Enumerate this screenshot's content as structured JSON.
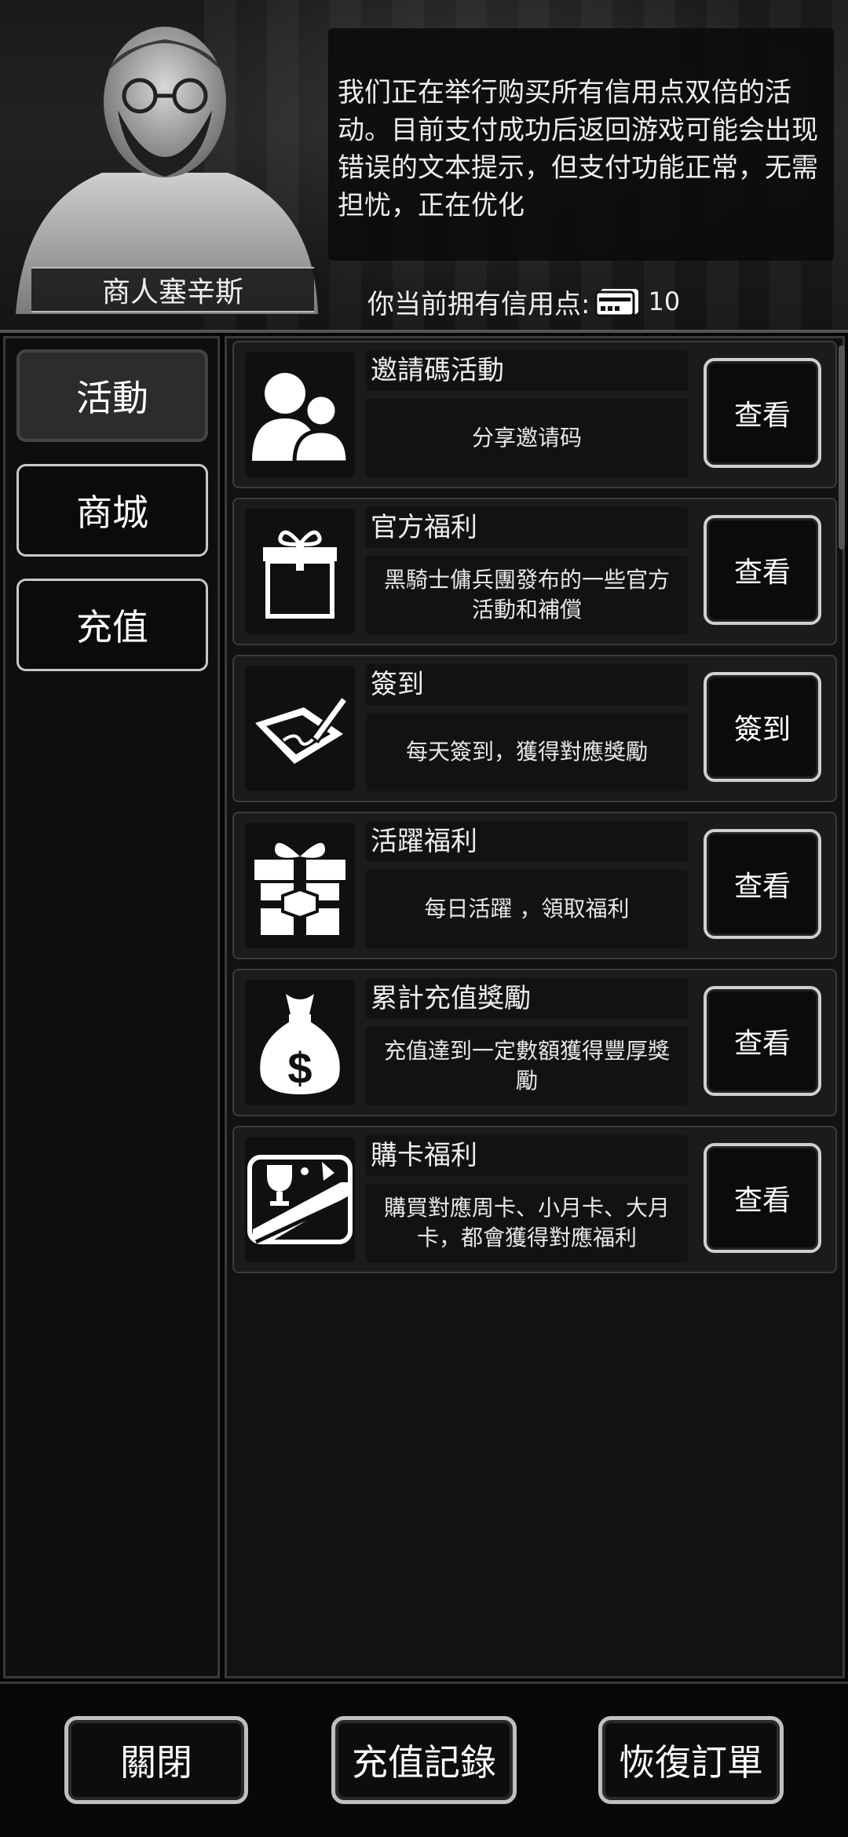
{
  "header": {
    "merchant_name": "商人塞辛斯",
    "notice": "我们正在举行购买所有信用点双倍的活动。目前支付成功后返回游戏可能会出现错误的文本提示，但支付功能正常，无需担忧，正在优化",
    "credits_label": "你当前拥有信用点:",
    "credits_value": "10",
    "credits_icon": "credit-card-icon"
  },
  "sidebar": {
    "items": [
      {
        "label": "活動",
        "active": true
      },
      {
        "label": "商城",
        "active": false
      },
      {
        "label": "充值",
        "active": false
      }
    ]
  },
  "activities": [
    {
      "title": "邀請碼活動",
      "desc": "分享邀请码",
      "button": "查看",
      "icon": "users-icon"
    },
    {
      "title": "官方福利",
      "desc": "黑騎士傭兵團發布的一些官方活動和補償",
      "button": "查看",
      "icon": "package-icon"
    },
    {
      "title": "簽到",
      "desc": "每天簽到，獲得對應獎勵",
      "button": "簽到",
      "icon": "tablet-pen-icon"
    },
    {
      "title": "活躍福利",
      "desc": "每日活躍 ，領取福利",
      "button": "查看",
      "icon": "gift-icon"
    },
    {
      "title": "累計充值獎勵",
      "desc": "充值達到一定數額獲得豐厚獎勵",
      "button": "查看",
      "icon": "money-bag-icon"
    },
    {
      "title": "購卡福利",
      "desc": "購買對應周卡、小月卡、大月卡，都會獲得對應福利",
      "button": "查看",
      "icon": "trophy-card-icon"
    }
  ],
  "footer": {
    "close_label": "關閉",
    "history_label": "充值記錄",
    "restore_label": "恢復訂單"
  }
}
